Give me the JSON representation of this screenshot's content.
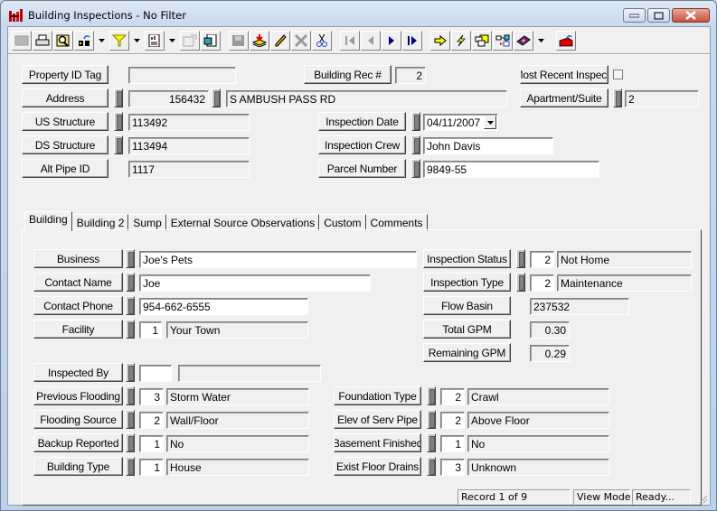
{
  "window": {
    "title": "Building Inspections - No Filter",
    "controls": [
      "minimize",
      "maximize",
      "close"
    ]
  },
  "toolbar": {
    "buttons": [
      {
        "icon": "grid-view-icon",
        "enabled": false
      },
      {
        "icon": "print-icon",
        "enabled": true
      },
      {
        "icon": "print-preview-icon",
        "enabled": true
      },
      {
        "icon": "find-icon",
        "enabled": true,
        "dropdown": true
      },
      {
        "icon": "filter-icon",
        "enabled": true,
        "dropdown": true
      },
      {
        "icon": "report-icon",
        "enabled": true,
        "dropdown": true
      },
      {
        "icon": "properties-icon",
        "enabled": false
      },
      {
        "icon": "export-icon",
        "enabled": true
      },
      {
        "icon": "save-icon",
        "enabled": false
      },
      {
        "icon": "add-record-icon",
        "enabled": true
      },
      {
        "icon": "edit-icon",
        "enabled": true
      },
      {
        "icon": "delete-icon",
        "enabled": false
      },
      {
        "icon": "cut-icon",
        "enabled": true
      },
      {
        "icon": "first-record-icon",
        "enabled": false
      },
      {
        "icon": "previous-record-icon",
        "enabled": false
      },
      {
        "icon": "next-record-icon",
        "enabled": true
      },
      {
        "icon": "last-record-icon",
        "enabled": true
      },
      {
        "icon": "goto-icon",
        "enabled": true
      },
      {
        "icon": "quick-action-icon",
        "enabled": true
      },
      {
        "icon": "related-records-icon",
        "enabled": true
      },
      {
        "icon": "hierarchy-icon",
        "enabled": true
      },
      {
        "icon": "help-book-icon",
        "enabled": true,
        "dropdown": true
      },
      {
        "icon": "exit-icon",
        "enabled": true
      }
    ]
  },
  "header": {
    "property_id_tag": {
      "label": "Property ID Tag",
      "value": ""
    },
    "building_rec": {
      "label": "Building Rec #",
      "value": "2"
    },
    "most_recent": {
      "label": "Most Recent Inspec",
      "checked": false
    },
    "address": {
      "label": "Address",
      "number": "156432",
      "street": "S AMBUSH PASS RD"
    },
    "apartment": {
      "label": "Apartment/Suite",
      "value": "2"
    },
    "us_structure": {
      "label": "US Structure",
      "value": "113492"
    },
    "inspection_date": {
      "label": "Inspection Date",
      "value": "04/11/2007"
    },
    "ds_structure": {
      "label": "DS Structure",
      "value": "113494"
    },
    "inspection_crew": {
      "label": "Inspection Crew",
      "value": "John Davis"
    },
    "alt_pipe_id": {
      "label": "Alt Pipe ID",
      "value": "1117"
    },
    "parcel_number": {
      "label": "Parcel Number",
      "value": "9849-55"
    }
  },
  "tabs": [
    {
      "label": "Building",
      "active": true
    },
    {
      "label": "Building 2",
      "active": false
    },
    {
      "label": "Sump",
      "active": false
    },
    {
      "label": "External Source Observations",
      "active": false
    },
    {
      "label": "Custom",
      "active": false
    },
    {
      "label": "Comments",
      "active": false
    }
  ],
  "building": {
    "business": {
      "label": "Business",
      "value": "Joe's Pets"
    },
    "contact_name": {
      "label": "Contact Name",
      "value": "Joe"
    },
    "contact_phone": {
      "label": "Contact Phone",
      "value": "954-662-6555"
    },
    "facility": {
      "label": "Facility",
      "code": "1",
      "value": "Your Town"
    },
    "inspection_status": {
      "label": "Inspection Status",
      "code": "2",
      "value": "Not Home"
    },
    "inspection_type": {
      "label": "Inspection Type",
      "code": "2",
      "value": "Maintenance"
    },
    "flow_basin": {
      "label": "Flow Basin",
      "value": "237532"
    },
    "total_gpm": {
      "label": "Total GPM",
      "value": "0.30"
    },
    "remaining_gpm": {
      "label": "Remaining GPM",
      "value": "0.29"
    },
    "inspected_by": {
      "label": "Inspected By",
      "code": "",
      "value": ""
    },
    "previous_flooding": {
      "label": "Previous Flooding",
      "code": "3",
      "value": "Storm Water"
    },
    "flooding_source": {
      "label": "Flooding Source",
      "code": "2",
      "value": "Wall/Floor"
    },
    "backup_reported": {
      "label": "Backup Reported",
      "code": "1",
      "value": "No"
    },
    "building_type": {
      "label": "Building Type",
      "code": "1",
      "value": "House"
    },
    "foundation_type": {
      "label": "Foundation Type",
      "code": "2",
      "value": "Crawl"
    },
    "elev_serv_pipe": {
      "label": "Elev of Serv Pipe",
      "code": "2",
      "value": "Above Floor"
    },
    "basement_finished": {
      "label": "Basement Finished",
      "code": "1",
      "value": "No"
    },
    "exist_floor_drains": {
      "label": "Exist Floor Drains",
      "code": "3",
      "value": "Unknown"
    }
  },
  "status_bar": {
    "record": "Record 1 of 9",
    "mode": "View Mode",
    "state": "Ready..."
  }
}
